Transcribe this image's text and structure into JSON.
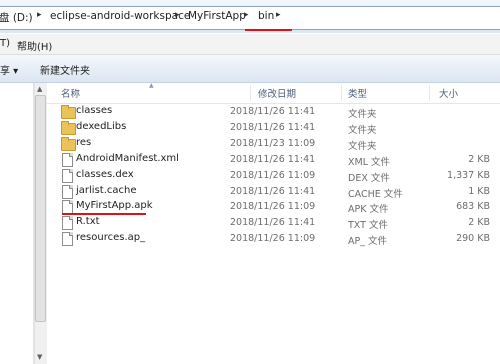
{
  "address": {
    "crumbs": [
      "盘 (D:)",
      "eclipse-android-workspace",
      "MyFirstApp",
      "bin"
    ],
    "separator": "▸"
  },
  "menubar": {
    "items": [
      "T)",
      "帮助(H)"
    ]
  },
  "toolbar": {
    "items": [
      "享 ▾",
      "新建文件夹"
    ]
  },
  "columns": {
    "name": "名称",
    "date": "修改日期",
    "type": "类型",
    "size": "大小"
  },
  "files": [
    {
      "name": "classes",
      "date": "2018/11/26 11:41",
      "type": "文件夹",
      "size": "",
      "icon": "folder-icon"
    },
    {
      "name": "dexedLibs",
      "date": "2018/11/26 11:41",
      "type": "文件夹",
      "size": "",
      "icon": "folder-icon"
    },
    {
      "name": "res",
      "date": "2018/11/23 11:09",
      "type": "文件夹",
      "size": "",
      "icon": "folder-icon"
    },
    {
      "name": "AndroidManifest.xml",
      "date": "2018/11/26 11:41",
      "type": "XML 文件",
      "size": "2 KB",
      "icon": "file-icon"
    },
    {
      "name": "classes.dex",
      "date": "2018/11/26 11:09",
      "type": "DEX 文件",
      "size": "1,337 KB",
      "icon": "file-icon"
    },
    {
      "name": "jarlist.cache",
      "date": "2018/11/26 11:41",
      "type": "CACHE 文件",
      "size": "1 KB",
      "icon": "file-icon"
    },
    {
      "name": "MyFirstApp.apk",
      "date": "2018/11/26 11:09",
      "type": "APK 文件",
      "size": "683 KB",
      "icon": "file-icon"
    },
    {
      "name": "R.txt",
      "date": "2018/11/26 11:41",
      "type": "TXT 文件",
      "size": "2 KB",
      "icon": "file-icon"
    },
    {
      "name": "resources.ap_",
      "date": "2018/11/26 11:09",
      "type": "AP_ 文件",
      "size": "290 KB",
      "icon": "file-icon"
    }
  ],
  "colors": {
    "highlight_underline": "#d8131a",
    "header_text": "#4c607a"
  }
}
